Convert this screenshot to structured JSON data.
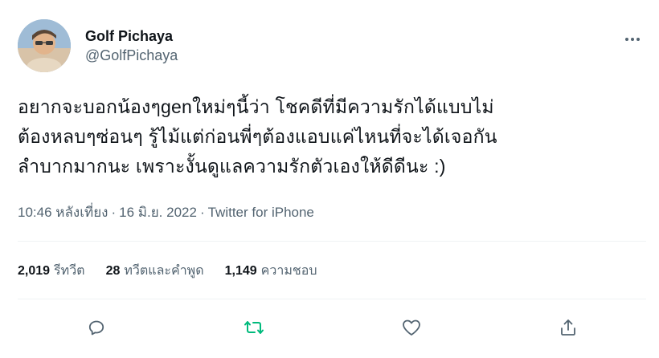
{
  "author": {
    "display_name": "Golf Pichaya",
    "handle": "@GolfPichaya",
    "avatar_icon": "profile-photo"
  },
  "tweet": {
    "lines": [
      "อยากจะบอกน้องๆgenใหม่ๆนี้ว่า โชคดีที่มีความรักได้แบบไม่",
      "ต้องหลบๆซ่อนๆ รู้ไม้แต่ก่อนพี่ๆต้องแอบแค่ไหนที่จะได้เจอกัน",
      "ลำบากมากนะ เพราะงั้นดูแลความรักตัวเองให้ดีดีนะ :)"
    ]
  },
  "meta": {
    "time": "10:46 หลังเที่ยง",
    "separator": "·",
    "date": "16 มิ.ย. 2022",
    "source": "Twitter for iPhone"
  },
  "stats": {
    "retweets_count": "2,019",
    "retweets_label": "รีทวีต",
    "quotes_count": "28",
    "quotes_label": "ทวีตและคำพูด",
    "likes_count": "1,149",
    "likes_label": "ความชอบ"
  },
  "icons": {
    "more": "more-horizontal-icon",
    "reply": "reply-icon",
    "retweet": "retweet-icon",
    "like": "like-icon",
    "share": "share-icon"
  },
  "colors": {
    "text_primary": "#0f1419",
    "text_secondary": "#536471",
    "retweet_active": "#00ba7c",
    "divider": "#eff3f4"
  }
}
